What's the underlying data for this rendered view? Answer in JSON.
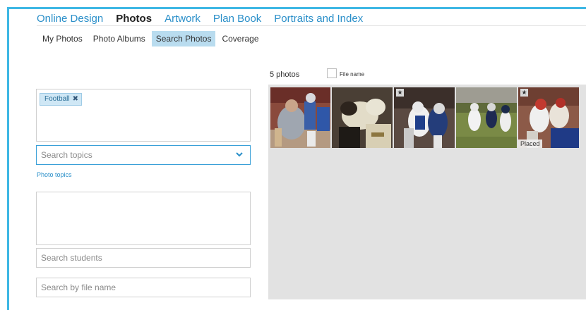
{
  "top_tabs": [
    {
      "label": "Online Design",
      "active": false
    },
    {
      "label": "Photos",
      "active": true
    },
    {
      "label": "Artwork",
      "active": false
    },
    {
      "label": "Plan Book",
      "active": false
    },
    {
      "label": "Portraits and Index",
      "active": false
    }
  ],
  "sub_tabs": [
    {
      "label": "My Photos",
      "active": false
    },
    {
      "label": "Photo Albums",
      "active": false
    },
    {
      "label": "Search Photos",
      "active": true
    },
    {
      "label": "Coverage",
      "active": false
    }
  ],
  "filters": {
    "selected_topic": "Football",
    "topics_placeholder": "Search topics",
    "photo_topics_link": "Photo topics",
    "students_placeholder": "Search students",
    "filename_placeholder": "Search by file name"
  },
  "results": {
    "count_label": "5 photos",
    "filename_toggle_label": "File name",
    "placed_label": "Placed"
  },
  "icons": [
    "close-x-icon",
    "chevron-down-icon",
    "star-icon"
  ],
  "colors": {
    "accent": "#2a8fc9",
    "frame": "#3db7e4",
    "active_subtab": "#b9dcef",
    "chip_bg": "#cfe7f5",
    "gallery_bg": "#e2e2e2"
  }
}
